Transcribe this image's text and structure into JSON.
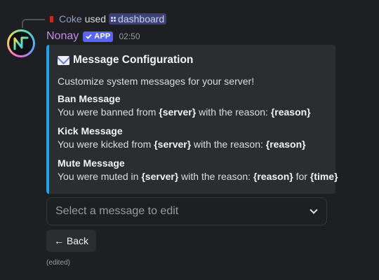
{
  "reply": {
    "user": "Coke",
    "used_text": "used",
    "command": "dashboard",
    "avatar_icon": "soda-can-icon"
  },
  "message": {
    "username": "Nonay",
    "app_tag": "APP",
    "timestamp": "02:50",
    "edited": "(edited)",
    "avatar_icon": "nonay-logo-icon"
  },
  "embed": {
    "accent_color": "#1ea5e6",
    "title_icon": "envelope-icon",
    "title": "Message Configuration",
    "description": "Customize system messages for your server!",
    "fields": [
      {
        "name": "Ban Message",
        "value": [
          {
            "text": "You were banned from ",
            "bold": false
          },
          {
            "text": "{server}",
            "bold": true
          },
          {
            "text": " with the reason: ",
            "bold": false
          },
          {
            "text": "{reason}",
            "bold": true
          }
        ]
      },
      {
        "name": "Kick Message",
        "value": [
          {
            "text": "You were kicked from ",
            "bold": false
          },
          {
            "text": "{server}",
            "bold": true
          },
          {
            "text": " with the reason: ",
            "bold": false
          },
          {
            "text": "{reason}",
            "bold": true
          }
        ]
      },
      {
        "name": "Mute Message",
        "value": [
          {
            "text": "You were muted in ",
            "bold": false
          },
          {
            "text": "{server}",
            "bold": true
          },
          {
            "text": " with the reason: ",
            "bold": false
          },
          {
            "text": "{reason}",
            "bold": true
          },
          {
            "text": " for ",
            "bold": false
          },
          {
            "text": "{time}",
            "bold": true
          }
        ]
      }
    ]
  },
  "select": {
    "placeholder": "Select a message to edit"
  },
  "back_button": {
    "label": "← Back"
  },
  "colors": {
    "username": "#c28de6",
    "app_tag": "#5865f2",
    "background": "#1e1f22",
    "embed_bg": "#2b2d31"
  }
}
